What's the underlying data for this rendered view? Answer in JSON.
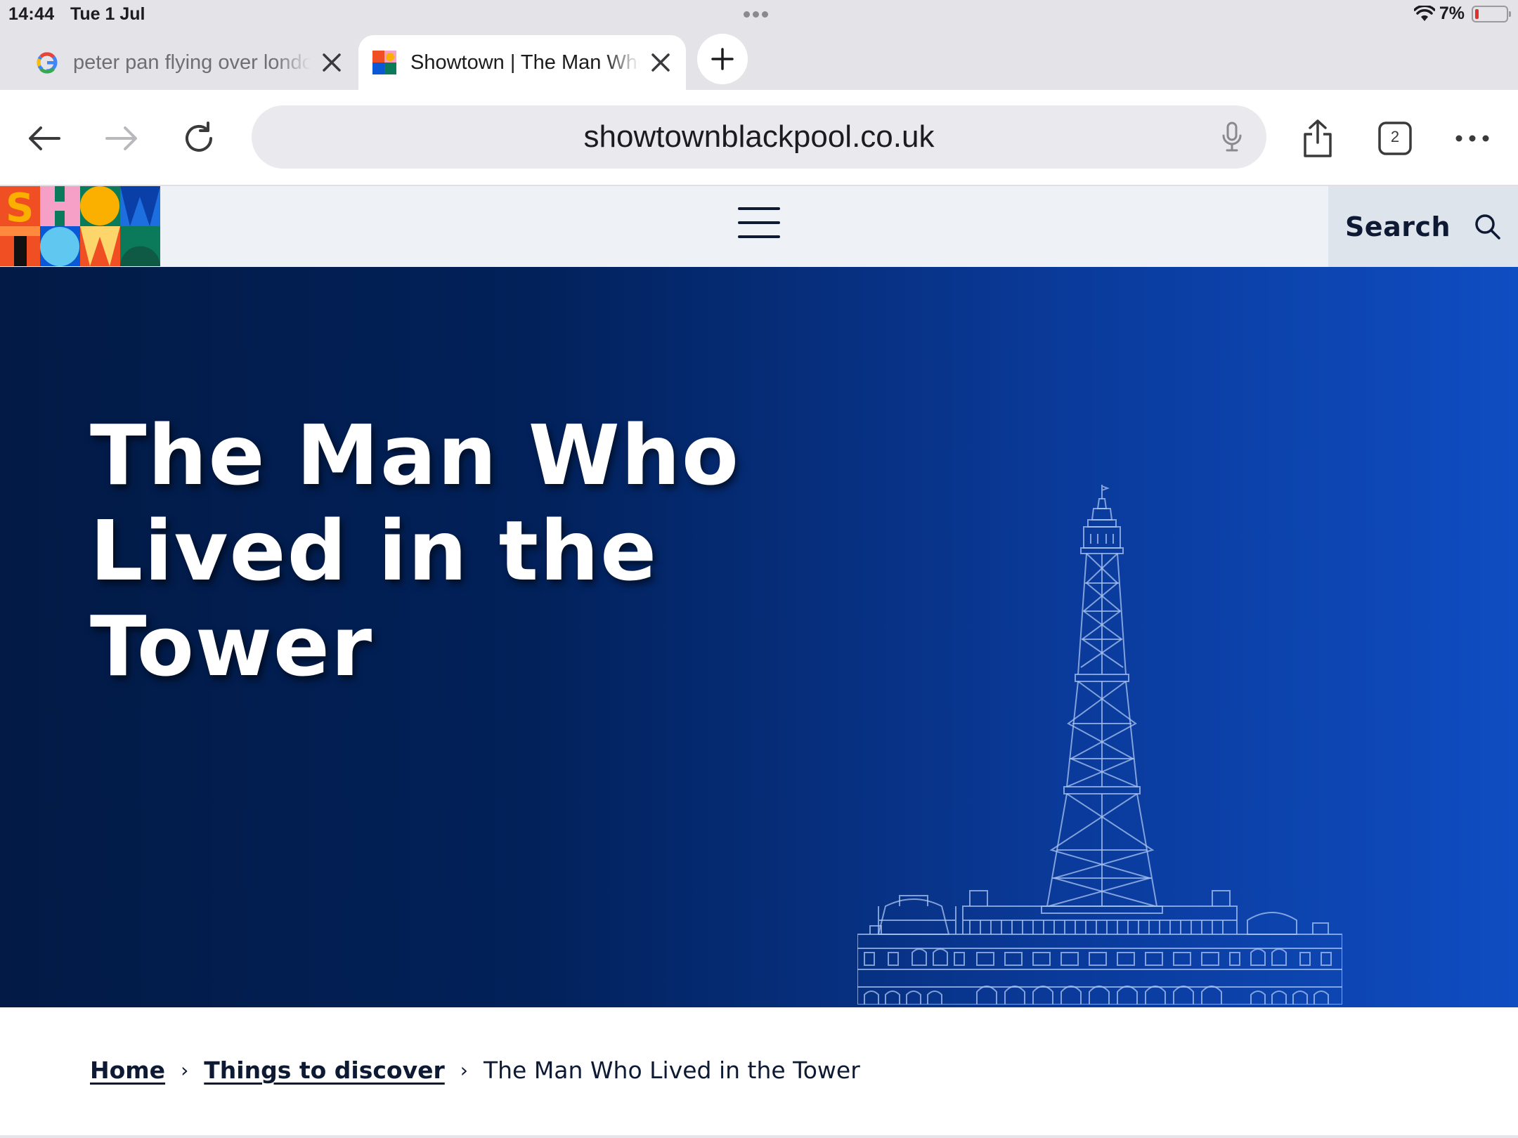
{
  "status_bar": {
    "time": "14:44",
    "date": "Tue 1 Jul",
    "battery_percent": "7%",
    "battery_level": 0.07
  },
  "tabs": [
    {
      "title": "peter pan flying over london",
      "favicon": "google-icon",
      "active": false
    },
    {
      "title": "Showtown | The Man Who Lived in the Tower",
      "favicon": "showtown-favicon",
      "active": true
    }
  ],
  "toolbar": {
    "url": "showtownblackpool.co.uk",
    "tab_count": "2"
  },
  "site_header": {
    "logo_text": "SHOWTOWN",
    "search_label": "Search"
  },
  "hero": {
    "title": "The Man Who Lived in the Tower",
    "colors": {
      "dark": "#021a45",
      "bright": "#0f4dc2"
    }
  },
  "breadcrumb": {
    "home": "Home",
    "section": "Things to discover",
    "current": "The Man Who Lived in the Tower"
  }
}
